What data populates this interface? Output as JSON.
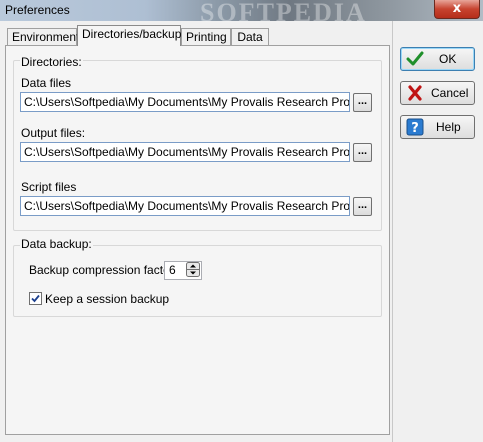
{
  "window": {
    "title": "Preferences",
    "watermark": "SOFTPEDIA",
    "close_label": "x"
  },
  "tabs": [
    {
      "label": "Environment"
    },
    {
      "label": "Directories/backup"
    },
    {
      "label": "Printing"
    },
    {
      "label": "Data"
    }
  ],
  "directories": {
    "group_label": "Directories:",
    "data_files": {
      "label": "Data files",
      "value": "C:\\Users\\Softpedia\\My Documents\\My Provalis Research Projects"
    },
    "output_files": {
      "label": "Output files:",
      "value": "C:\\Users\\Softpedia\\My Documents\\My Provalis Research Projects"
    },
    "script_files": {
      "label": "Script files",
      "value": "C:\\Users\\Softpedia\\My Documents\\My Provalis Research Projects\\"
    },
    "browse_label": "..."
  },
  "backup": {
    "group_label": "Data backup:",
    "compression_label": "Backup compression factor:",
    "compression_value": "6",
    "keep_session_label": "Keep a session backup",
    "keep_session_checked": true
  },
  "buttons": {
    "ok": "OK",
    "cancel": "Cancel",
    "help": "Help"
  }
}
